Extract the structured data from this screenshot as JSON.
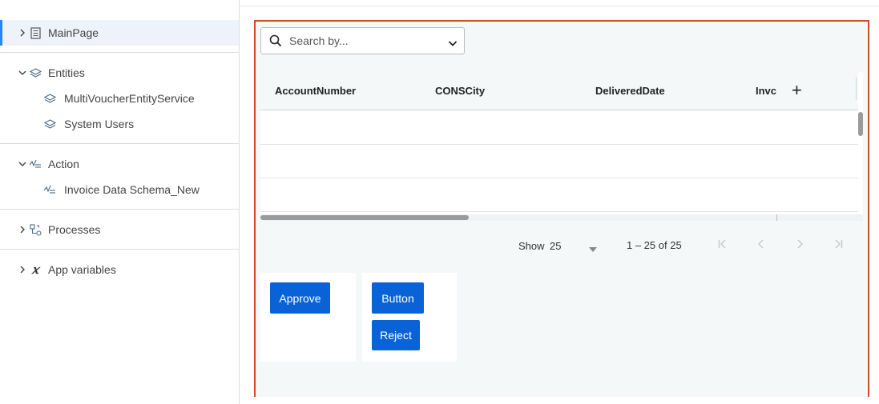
{
  "sidebar": {
    "main_page": {
      "label": "MainPage"
    },
    "entities": {
      "label": "Entities",
      "items": [
        {
          "label": "MultiVoucherEntityService"
        },
        {
          "label": "System Users"
        }
      ]
    },
    "action": {
      "label": "Action",
      "items": [
        {
          "label": "Invoice Data Schema_New"
        }
      ]
    },
    "processes": {
      "label": "Processes"
    },
    "app_variables": {
      "label": "App variables"
    }
  },
  "canvas": {
    "search": {
      "placeholder": "Search by..."
    },
    "grid": {
      "columns": [
        "AccountNumber",
        "CONSCity",
        "DeliveredDate",
        "Invc"
      ],
      "rows": [
        [
          "",
          "",
          "",
          ""
        ],
        [
          "",
          "",
          "",
          ""
        ],
        [
          "",
          "",
          "",
          ""
        ]
      ]
    },
    "pager": {
      "show_label": "Show",
      "page_size": "25",
      "range": "1 – 25 of 25"
    },
    "buttons": {
      "approve": "Approve",
      "button": "Button",
      "reject": "Reject"
    }
  },
  "colors": {
    "accent": "#0a63d6",
    "selection_bar": "#2684ff",
    "canvas_border": "#d24726"
  }
}
